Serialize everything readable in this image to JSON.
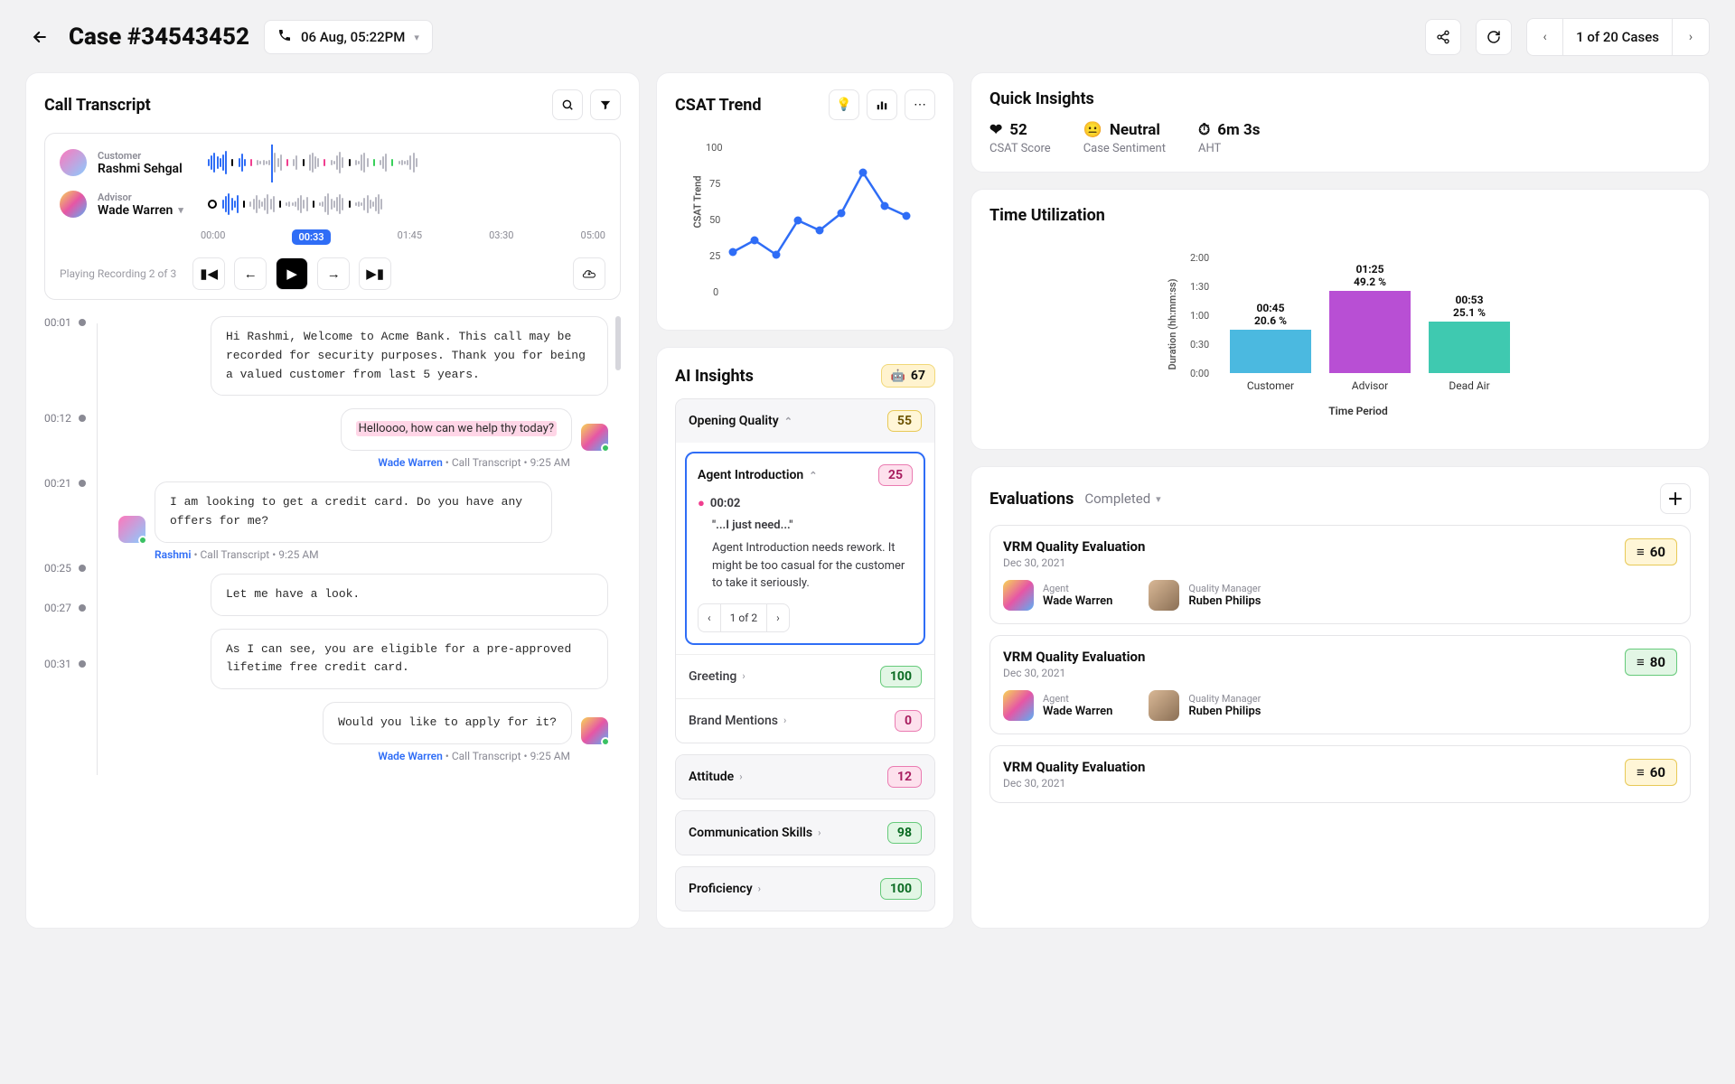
{
  "header": {
    "title": "Case #34543452",
    "date": "06 Aug, 05:22PM",
    "pager_label": "1 of 20 Cases"
  },
  "transcript": {
    "title": "Call Transcript",
    "customer_role": "Customer",
    "customer_name": "Rashmi Sehgal",
    "advisor_role": "Advisor",
    "advisor_name": "Wade Warren",
    "time_ticks": [
      "00:00",
      "00:33",
      "01:45",
      "03:30",
      "05:00"
    ],
    "playing_label": "Playing Recording 2 of 3",
    "tl": [
      "00:01",
      "00:12",
      "00:21",
      "00:25",
      "00:27",
      "00:31"
    ],
    "msgs": {
      "m1": "Hi Rashmi, Welcome to Acme Bank. This call may be recorded for security purposes. Thank you for being a valued customer from last 5 years.",
      "m2": "Helloooo, how can we help thy today?",
      "m3": "I am looking to get a credit card. Do you have any offers for me?",
      "m4": "Let me have a look.",
      "m5": "As I can see, you are eligible for a pre-approved lifetime free credit card.",
      "m6": "Would you like to apply for it?"
    },
    "meta_wade": "Wade Warren",
    "meta_rashmi": "Rashmi",
    "meta_suffix": " • Call Transcript • 9:25 AM"
  },
  "csat": {
    "title": "CSAT Trend",
    "ylabel": "CSAT Trend"
  },
  "chart_data": {
    "type": "line",
    "title": "CSAT Trend",
    "ylabel": "CSAT Trend",
    "ylim": [
      0,
      100
    ],
    "yticks": [
      0,
      25,
      50,
      75,
      100
    ],
    "x": [
      1,
      2,
      3,
      4,
      5,
      6,
      7,
      8,
      9
    ],
    "values": [
      30,
      38,
      28,
      52,
      45,
      57,
      85,
      62,
      55
    ]
  },
  "ai": {
    "title": "AI Insights",
    "overall": "67",
    "sections": {
      "opening": {
        "title": "Opening Quality",
        "score": "55"
      },
      "agent_intro": {
        "title": "Agent Introduction",
        "score": "25"
      },
      "greeting": {
        "title": "Greeting",
        "score": "100"
      },
      "brand": {
        "title": "Brand Mentions",
        "score": "0"
      },
      "attitude": {
        "title": "Attitude",
        "score": "12"
      },
      "comm": {
        "title": "Communication Skills",
        "score": "98"
      },
      "prof": {
        "title": "Proficiency",
        "score": "100"
      }
    },
    "detail": {
      "ts": "00:02",
      "quote": "\"...I just need...\"",
      "body": "Agent Introduction needs rework. It might be too casual for the customer to take it seriously.",
      "pager": "1 of 2"
    }
  },
  "quick": {
    "title": "Quick Insights",
    "csat_value": "52",
    "csat_label": "CSAT Score",
    "sentiment_value": "Neutral",
    "sentiment_label": "Case Sentiment",
    "aht_value": "6m 3s",
    "aht_label": "AHT"
  },
  "time_util": {
    "title": "Time Utilization",
    "xlabel": "Time Period",
    "ylabel": "Duration (hh:mm:ss)",
    "yticks": [
      "0:00",
      "0:30",
      "1:00",
      "1:30",
      "2:00"
    ],
    "bars": [
      {
        "label": "Customer",
        "time": "00:45",
        "pct": "20.6 %"
      },
      {
        "label": "Advisor",
        "time": "01:25",
        "pct": "49.2 %"
      },
      {
        "label": "Dead Air",
        "time": "00:53",
        "pct": "25.1 %"
      }
    ]
  },
  "time_util_chart": {
    "type": "bar",
    "categories": [
      "Customer",
      "Advisor",
      "Dead Air"
    ],
    "values_seconds": [
      45,
      85,
      53
    ],
    "percent": [
      20.6,
      49.2,
      25.1
    ],
    "ylabel": "Duration (hh:mm:ss)",
    "xlabel": "Time Period",
    "yticks_seconds": [
      0,
      30,
      60,
      90,
      120
    ],
    "colors": [
      "#4bb9e0",
      "#b84fd4",
      "#3fc9b0"
    ]
  },
  "evals": {
    "title": "Evaluations",
    "filter": "Completed",
    "items": [
      {
        "title": "VRM Quality Evaluation",
        "date": "Dec 30, 2021",
        "score": "60",
        "tone": "yellow",
        "agent": "Wade Warren",
        "mgr": "Ruben Philips"
      },
      {
        "title": "VRM Quality Evaluation",
        "date": "Dec 30, 2021",
        "score": "80",
        "tone": "green",
        "agent": "Wade Warren",
        "mgr": "Ruben Philips"
      },
      {
        "title": "VRM Quality Evaluation",
        "date": "Dec 30, 2021",
        "score": "60",
        "tone": "yellow"
      }
    ],
    "agent_role": "Agent",
    "mgr_role": "Quality Manager"
  }
}
